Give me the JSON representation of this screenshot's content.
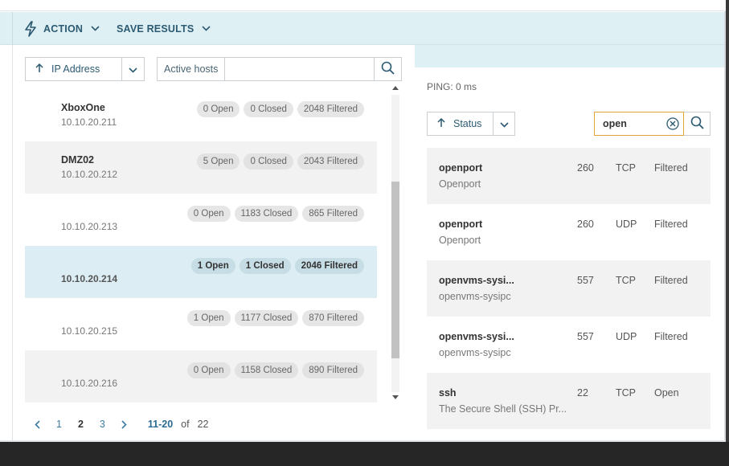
{
  "toolbar": {
    "action_label": "ACTION",
    "save_results_label": "SAVE RESULTS"
  },
  "hosts_panel": {
    "sort_label": "IP Address",
    "filter_label": "Active hosts",
    "filter_value": "",
    "hosts": [
      {
        "name": "XboxOne",
        "ip": "10.10.20.211",
        "open": "0 Open",
        "closed": "0 Closed",
        "filtered": "2048 Filtered"
      },
      {
        "name": "DMZ02",
        "ip": "10.10.20.212",
        "open": "5 Open",
        "closed": "0 Closed",
        "filtered": "2043 Filtered"
      },
      {
        "name": "",
        "ip": "10.10.20.213",
        "open": "0 Open",
        "closed": "1183 Closed",
        "filtered": "865 Filtered"
      },
      {
        "name": "",
        "ip": "10.10.20.214",
        "open": "1 Open",
        "closed": "1 Closed",
        "filtered": "2046 Filtered"
      },
      {
        "name": "",
        "ip": "10.10.20.215",
        "open": "1 Open",
        "closed": "1177 Closed",
        "filtered": "870 Filtered"
      },
      {
        "name": "",
        "ip": "10.10.20.216",
        "open": "0 Open",
        "closed": "1158 Closed",
        "filtered": "890 Filtered"
      }
    ],
    "selected_index": 3,
    "pagination": {
      "pages": [
        "1",
        "2",
        "3"
      ],
      "current_page": "2",
      "range": "11-20",
      "of_label": "of",
      "total": "22"
    }
  },
  "ports_panel": {
    "ping": "PING: 0 ms",
    "sort_label": "Status",
    "search_value": "open",
    "ports": [
      {
        "name": "openport",
        "desc": "Openport",
        "port": "260",
        "proto": "TCP",
        "state": "Filtered"
      },
      {
        "name": "openport",
        "desc": "Openport",
        "port": "260",
        "proto": "UDP",
        "state": "Filtered"
      },
      {
        "name": "openvms-sysi...",
        "desc": "openvms-sysipc",
        "port": "557",
        "proto": "TCP",
        "state": "Filtered"
      },
      {
        "name": "openvms-sysi...",
        "desc": "openvms-sysipc",
        "port": "557",
        "proto": "UDP",
        "state": "Filtered"
      },
      {
        "name": "ssh",
        "desc": "The Secure Shell (SSH) Pr...",
        "port": "22",
        "proto": "TCP",
        "state": "Open"
      }
    ]
  },
  "colors": {
    "toolbar_bg": "#dff0f4",
    "accent": "#2b5a72",
    "link": "#3a7ca5",
    "selected_row": "#dcedf3",
    "search_focus": "#e0a33a"
  },
  "icons": [
    "lightning-icon",
    "chevron-down-icon",
    "sort-up-arrow-icon",
    "search-icon",
    "clear-icon",
    "chevron-left-icon",
    "chevron-right-icon",
    "scroll-up-icon",
    "scroll-down-icon"
  ]
}
